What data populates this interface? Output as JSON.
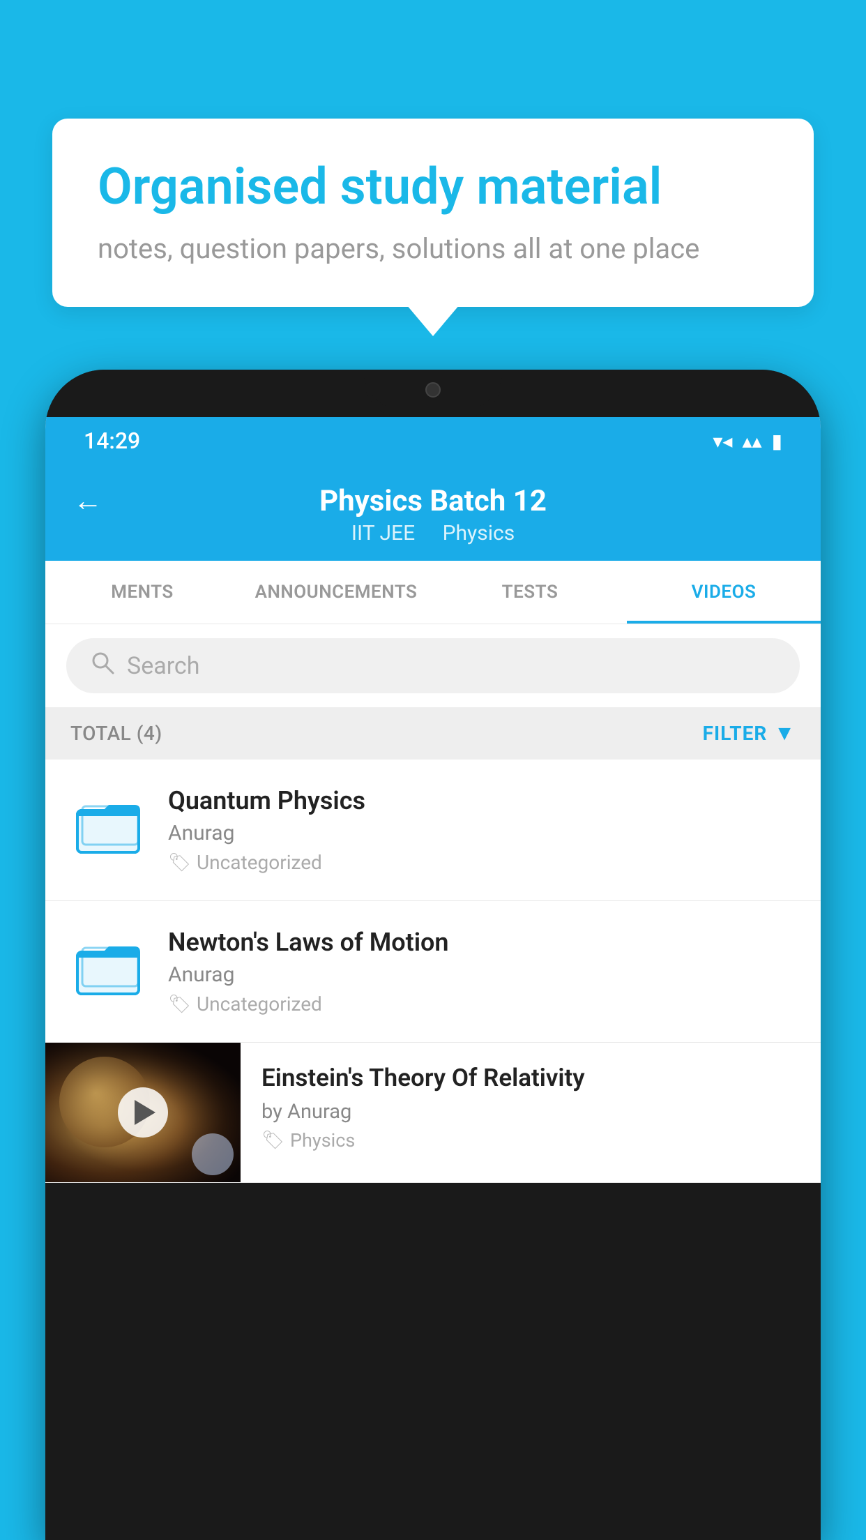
{
  "background": {
    "color": "#1ab8e8"
  },
  "speech_bubble": {
    "title": "Organised study material",
    "subtitle": "notes, question papers, solutions all at one place"
  },
  "status_bar": {
    "time": "14:29",
    "wifi_icon": "▾",
    "signal_icon": "▾",
    "battery_icon": "▮"
  },
  "header": {
    "back_label": "←",
    "title": "Physics Batch 12",
    "subtitle_part1": "IIT JEE",
    "subtitle_part2": "Physics"
  },
  "tabs": [
    {
      "label": "MENTS",
      "active": false
    },
    {
      "label": "ANNOUNCEMENTS",
      "active": false
    },
    {
      "label": "TESTS",
      "active": false
    },
    {
      "label": "VIDEOS",
      "active": true
    }
  ],
  "search": {
    "placeholder": "Search"
  },
  "total_bar": {
    "label": "TOTAL (4)",
    "filter_label": "FILTER"
  },
  "video_items": [
    {
      "title": "Quantum Physics",
      "author": "Anurag",
      "tag": "Uncategorized",
      "type": "folder"
    },
    {
      "title": "Newton's Laws of Motion",
      "author": "Anurag",
      "tag": "Uncategorized",
      "type": "folder"
    },
    {
      "title": "Einstein's Theory Of Relativity",
      "author": "by Anurag",
      "tag": "Physics",
      "type": "video"
    }
  ]
}
